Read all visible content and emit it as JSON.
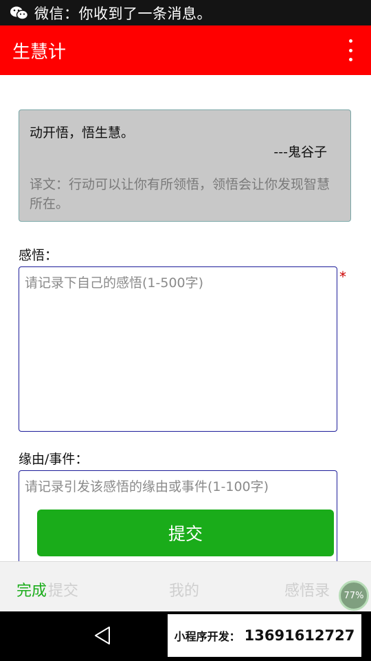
{
  "status_bar": {
    "notification": "微信：你收到了一条消息。"
  },
  "app_bar": {
    "title": "生慧计",
    "menu_icon": "more-vert-icon"
  },
  "quote": {
    "text": "动开悟，悟生慧。",
    "author": "---鬼谷子",
    "translation": "译文：行动可以让你有所领悟，领悟会让你发现智慧所在。"
  },
  "form": {
    "insight_label": "感悟：",
    "insight_placeholder": "请记录下自己的感悟(1-500字)",
    "required_mark": "*",
    "reason_label": "缘由/事件：",
    "reason_placeholder": "请记录引发该感悟的缘由或事件(1-100字)",
    "submit_label": "提交"
  },
  "bottom_bar": {
    "done_label": "完成",
    "tabs": [
      "提交",
      "我的",
      "感悟录"
    ],
    "progress": "77%"
  },
  "nav_bar": {
    "back_icon": "back-triangle-icon"
  },
  "promo": {
    "label": "小程序开发：",
    "phone": "13691612727"
  },
  "colors": {
    "app_bar": "#ff0000",
    "submit": "#1aac1a",
    "field_border": "#1c1c99",
    "quote_bg": "#c8c8c8"
  }
}
